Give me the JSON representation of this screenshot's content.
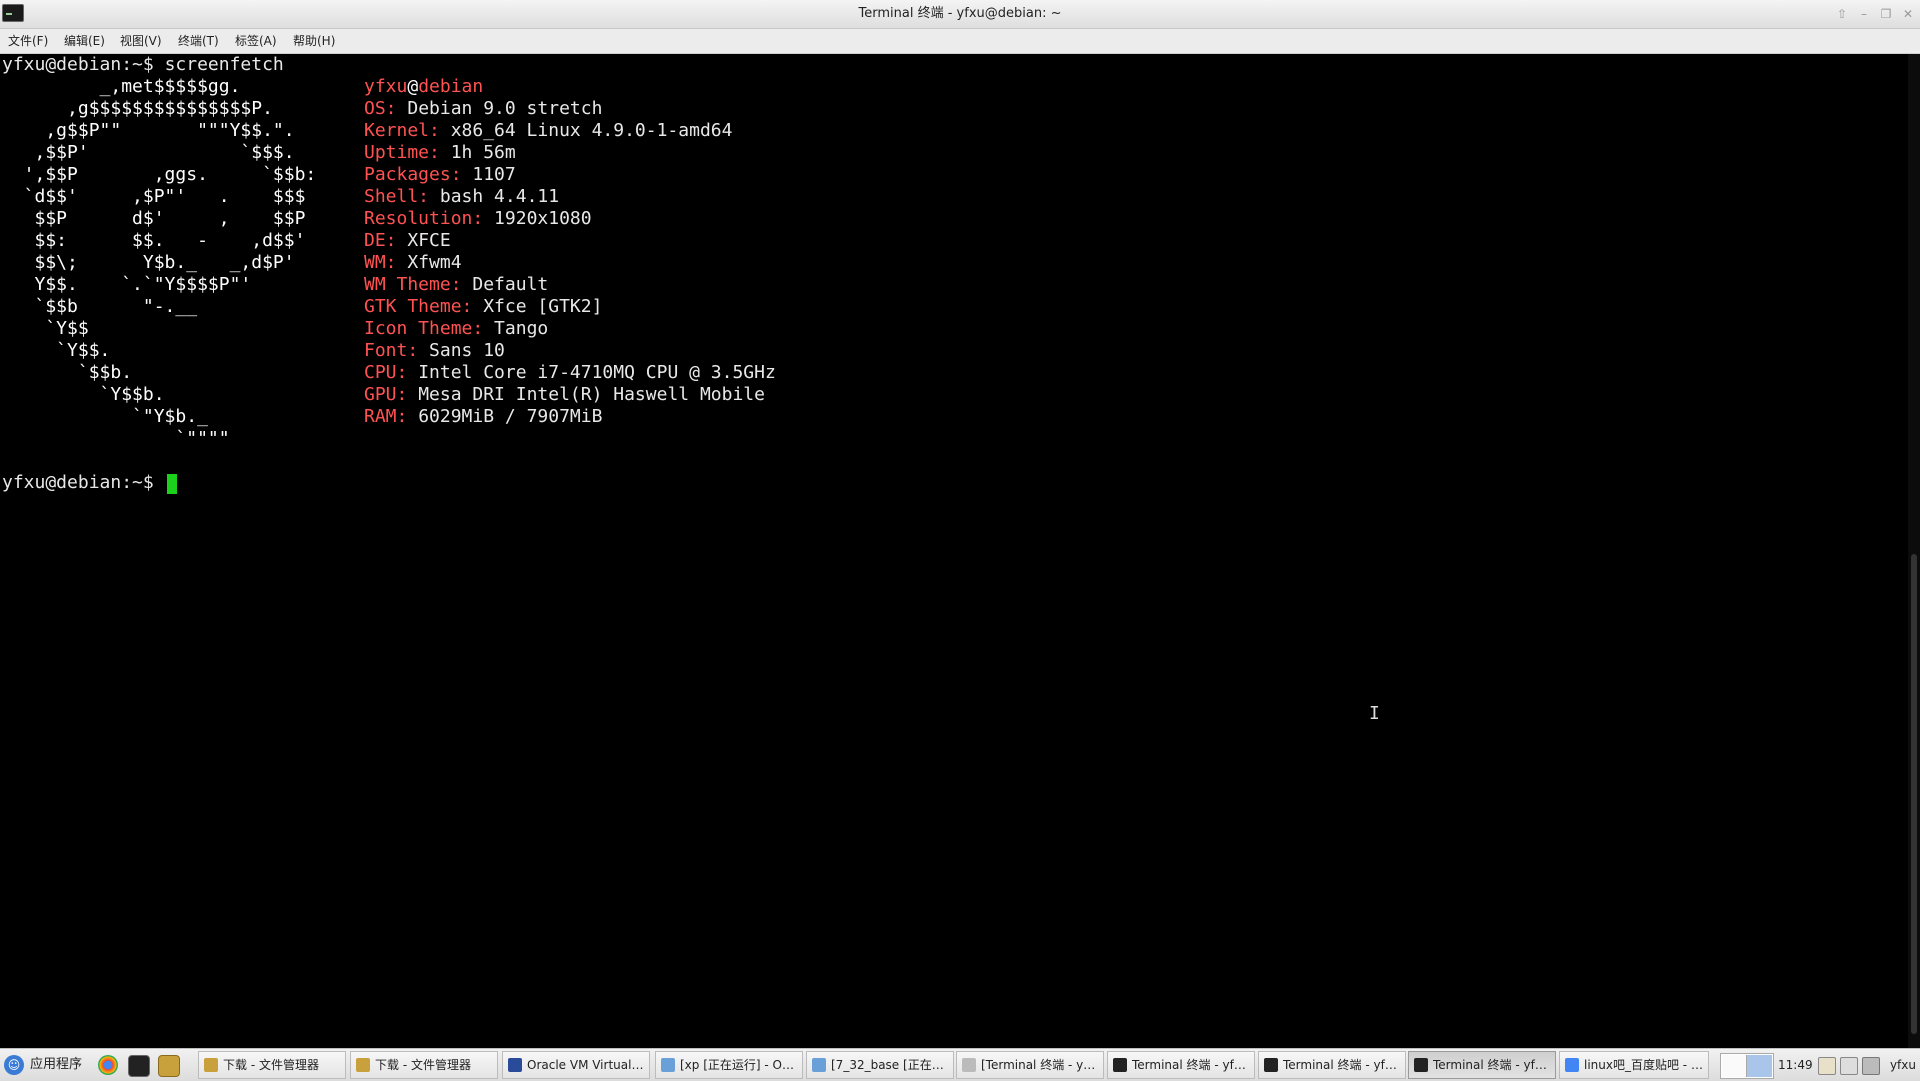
{
  "window": {
    "title": "Terminal 终端 - yfxu@debian: ~"
  },
  "menu": {
    "file": "文件(F)",
    "edit": "编辑(E)",
    "view": "视图(V)",
    "terminal": "终端(T)",
    "tabs": "标签(A)",
    "help": "帮助(H)"
  },
  "terminal": {
    "prompt": "yfxu@debian:~$",
    "command": "screenfetch",
    "prompt2": "yfxu@debian:~$",
    "logo_lines": [
      "         _,met$$$$$gg.",
      "      ,g$$$$$$$$$$$$$$$P.",
      "    ,g$$P\"\"       \"\"\"Y$$.\".",
      "   ,$$P'              `$$$.",
      "  ',$$P       ,ggs.     `$$b:",
      "  `d$$'     ,$P\"'   .    $$$",
      "   $$P      d$'     ,    $$P",
      "   $$:      $$.   -    ,d$$'",
      "   $$\\;      Y$b._   _,d$P'",
      "   Y$$.    `.`\"Y$$$$P\"'",
      "   `$$b      \"-.__",
      "    `Y$$",
      "     `Y$$.",
      "       `$$b.",
      "         `Y$$b.",
      "            `\"Y$b._",
      "                `\"\"\"\""
    ],
    "user": "yfxu",
    "at": "@",
    "host": "debian",
    "info": [
      {
        "key": "OS:",
        "value": " Debian 9.0 stretch"
      },
      {
        "key": "Kernel:",
        "value": " x86_64 Linux 4.9.0-1-amd64"
      },
      {
        "key": "Uptime:",
        "value": " 1h 56m"
      },
      {
        "key": "Packages:",
        "value": " 1107"
      },
      {
        "key": "Shell:",
        "value": " bash 4.4.11"
      },
      {
        "key": "Resolution:",
        "value": " 1920x1080"
      },
      {
        "key": "DE:",
        "value": " XFCE"
      },
      {
        "key": "WM:",
        "value": " Xfwm4"
      },
      {
        "key": "WM Theme:",
        "value": " Default"
      },
      {
        "key": "GTK Theme:",
        "value": " Xfce [GTK2]"
      },
      {
        "key": "Icon Theme:",
        "value": " Tango"
      },
      {
        "key": "Font:",
        "value": " Sans 10"
      },
      {
        "key": "CPU:",
        "value": " Intel Core i7-4710MQ CPU @ 3.5GHz"
      },
      {
        "key": "GPU:",
        "value": " Mesa DRI Intel(R) Haswell Mobile"
      },
      {
        "key": "RAM:",
        "value": " 6029MiB / 7907MiB"
      }
    ]
  },
  "taskbar": {
    "start_label": "应用程序",
    "tasks": [
      "下载 - 文件管理器",
      "下载 - 文件管理器",
      "Oracle VM VirtualB…",
      "[xp [正在运行] - Or…",
      "[7_32_base [正在运…",
      "[Terminal 终端 - yf…",
      "Terminal 终端 - yfx…",
      "Terminal 终端 - yfx…",
      "Terminal 终端 - yfx…",
      "linux吧_百度贴吧 - …"
    ],
    "clock": "11:49",
    "user": "yfxu"
  },
  "colors": {
    "accent_red": "#ff5252",
    "cursor_green": "#1bd11b",
    "background": "#000000"
  }
}
